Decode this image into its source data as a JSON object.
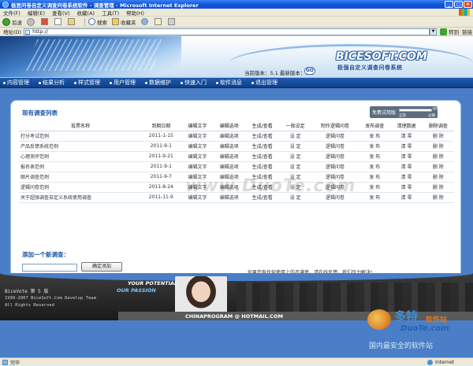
{
  "window": {
    "title": "极思问卷自定义调查问卷系统软件 - 调查管理 - Microsoft Internet Explorer"
  },
  "menu": [
    "文件(F)",
    "编辑(E)",
    "查看(V)",
    "收藏(A)",
    "工具(T)",
    "帮助(H)"
  ],
  "toolbar": {
    "back": "后退",
    "search": "搜索",
    "favorites": "收藏夹"
  },
  "address": {
    "label": "地址(D)",
    "value": "http://",
    "go": "转到",
    "links": "链接"
  },
  "banner": {
    "logo": "BICESOFT.COM",
    "logo_sub": "极强自定义调查问卷系统",
    "version": "当前版本：5.1 最新版本：5.1",
    "go": "GO"
  },
  "nav": [
    "内容管理",
    "结果分析",
    "样式管理",
    "用户管理",
    "数据维护",
    "快速入门",
    "软件消息",
    "退出管理"
  ],
  "list": {
    "title": "现有调查列表",
    "trial": {
      "label": "免费试用版",
      "fill_percent": 0,
      "pct": "0%",
      "scale_left": "正常",
      "scale_right": "过期"
    },
    "headers": [
      "投票名称",
      "到期日期",
      "编辑文字",
      "编辑选项",
      "生成/查看",
      "一般设定",
      "制作逻辑问卷",
      "发布调查",
      "清理数据",
      "删除调查"
    ],
    "rows": [
      [
        "打分考试范例",
        "2011-1-15",
        "编辑文字",
        "编辑选项",
        "生成/查看",
        "设 定",
        "逻辑问卷",
        "发 布",
        "清 零",
        "删 除"
      ],
      [
        "产品反馈系统范例",
        "2011-9-1",
        "编辑文字",
        "编辑选项",
        "生成/查看",
        "设 定",
        "逻辑问卷",
        "发 布",
        "清 零",
        "删 除"
      ],
      [
        "心理测评范例",
        "2011-9-21",
        "编辑文字",
        "编辑选项",
        "生成/查看",
        "设 定",
        "逻辑问卷",
        "发 布",
        "清 零",
        "删 除"
      ],
      [
        "报名表范例",
        "2011-9-1",
        "编辑文字",
        "编辑选项",
        "生成/查看",
        "设 定",
        "逻辑问卷",
        "发 布",
        "清 零",
        "删 除"
      ],
      [
        "图片调查范例",
        "2011-9-7",
        "编辑文字",
        "编辑选项",
        "生成/查看",
        "设 定",
        "逻辑问卷",
        "发 布",
        "清 零",
        "删 除"
      ],
      [
        "逻辑问卷范例",
        "2011-8-24",
        "编辑文字",
        "编辑选项",
        "生成/查看",
        "设 定",
        "逻辑问卷",
        "发 布",
        "清 零",
        "删 除"
      ],
      [
        "关于超强调查自定义系统使用调查",
        "2011-11-9",
        "编辑文字",
        "编辑选项",
        "生成/查看",
        "设 定",
        "逻辑问卷",
        "发 布",
        "清 零",
        "删 除"
      ]
    ]
  },
  "add": {
    "title": "添加一个新调查：",
    "input_value": "",
    "button": "确定添加",
    "feedback": "如果您有任何使用上的不满意，请在线反馈，我们尽力解决!"
  },
  "footer": {
    "product": "BiceVote 第 5 版",
    "copy1": "1999-2007 BiceSoft.Com Develop Team",
    "copy2": "All Rights Reserved",
    "potential": "YOUR POTENTIAL",
    "passion": "OUR PASSION",
    "email": "CHINAPROGRAM @ HOTMAIL.COM"
  },
  "watermark": {
    "center": "www.DuoTe.com",
    "brand": "多特",
    "soft": "软件站",
    "domain": "DuoTe.com",
    "slogan": "国内最安全的软件站"
  },
  "status": {
    "left": "完毕",
    "zone": "Internet"
  }
}
